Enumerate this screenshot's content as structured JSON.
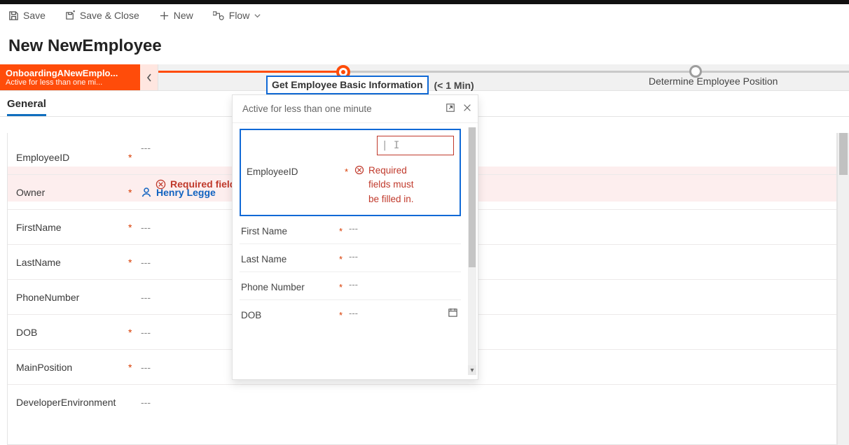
{
  "commands": {
    "save": "Save",
    "save_close": "Save & Close",
    "new": "New",
    "flow": "Flow"
  },
  "page": {
    "title": "New NewEmployee"
  },
  "bpf": {
    "process_name": "OnboardingANewEmplo...",
    "process_sub": "Active for less than one mi...",
    "stage1_name": "Get Employee Basic Information",
    "stage1_time": "(< 1 Min)",
    "stage2_name": "Determine Employee Position"
  },
  "tabs": {
    "general": "General"
  },
  "form": {
    "employee_id": {
      "label": "EmployeeID",
      "value": "---",
      "required": "*"
    },
    "error_banner": "Required fields",
    "owner": {
      "label": "Owner",
      "required": "*",
      "value": "Henry Legge"
    },
    "first_name": {
      "label": "FirstName",
      "required": "*",
      "value": "---"
    },
    "last_name": {
      "label": "LastName",
      "required": "*",
      "value": "---"
    },
    "phone": {
      "label": "PhoneNumber",
      "required": "",
      "value": "---"
    },
    "dob": {
      "label": "DOB",
      "required": "*",
      "value": "---"
    },
    "main_position": {
      "label": "MainPosition",
      "required": "*",
      "value": "---"
    },
    "dev_env": {
      "label": "DeveloperEnvironment",
      "required": "",
      "value": "---"
    }
  },
  "flyout": {
    "header": "Active for less than one minute",
    "cursor": "|  I",
    "employee_id_label": "EmployeeID",
    "req": "*",
    "error1": "Required",
    "error2": "fields must",
    "error3": "be filled in.",
    "first_name": "First Name",
    "last_name": "Last Name",
    "phone": "Phone Number",
    "dob": "DOB",
    "dash": "---"
  }
}
